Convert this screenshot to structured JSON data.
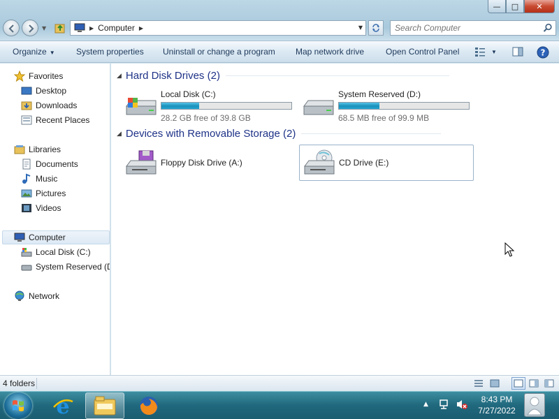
{
  "window": {
    "caption_buttons": {
      "minimize": "—",
      "maximize": "□",
      "close": "✕"
    }
  },
  "address": {
    "crumb": "Computer",
    "search_placeholder": "Search Computer"
  },
  "toolbar": {
    "organize": "Organize",
    "system_properties": "System properties",
    "uninstall": "Uninstall or change a program",
    "map_drive": "Map network drive",
    "control_panel": "Open Control Panel"
  },
  "nav": {
    "favorites": "Favorites",
    "desktop": "Desktop",
    "downloads": "Downloads",
    "recent": "Recent Places",
    "libraries": "Libraries",
    "documents": "Documents",
    "music": "Music",
    "pictures": "Pictures",
    "videos": "Videos",
    "computer": "Computer",
    "local_disk": "Local Disk (C:)",
    "system_reserved": "System Reserved (D:",
    "network": "Network"
  },
  "groups": {
    "hard_disks": "Hard Disk Drives (2)",
    "removable": "Devices with Removable Storage (2)"
  },
  "drives": {
    "c": {
      "name": "Local Disk (C:)",
      "free": "28.2 GB free of 39.8 GB",
      "used_fraction": 0.29
    },
    "d": {
      "name": "System Reserved (D:)",
      "free": "68.5 MB free of 99.9 MB",
      "used_fraction": 0.31
    },
    "a": {
      "name": "Floppy Disk Drive (A:)"
    },
    "e": {
      "name": "CD Drive (E:)"
    }
  },
  "status": {
    "text": "4 folders"
  },
  "clock": {
    "time": "8:43 PM",
    "date": "7/27/2022"
  },
  "colors": {
    "accent": "#1e3287",
    "progress": "#26a7d4",
    "taskbar": "#20687d"
  }
}
